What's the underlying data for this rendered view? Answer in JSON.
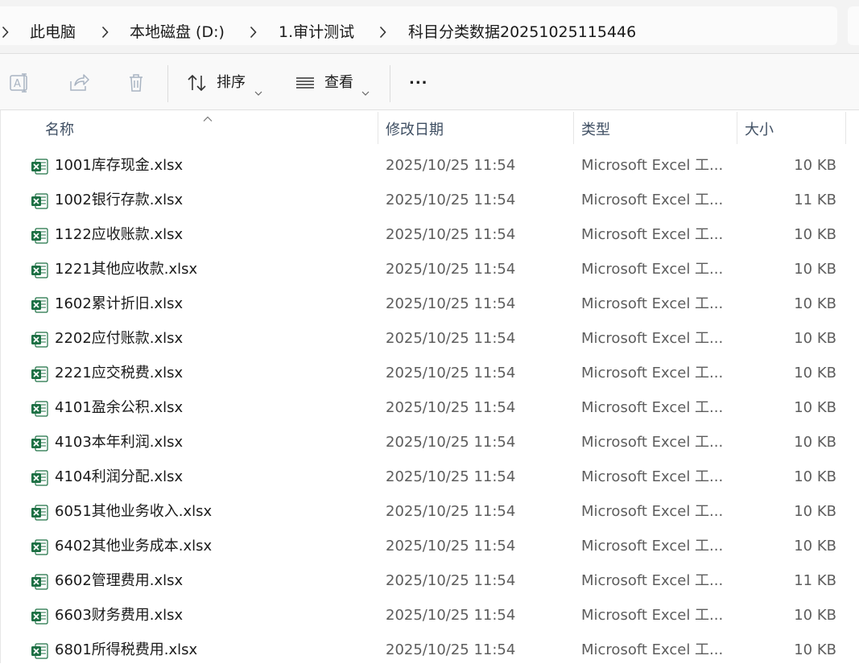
{
  "breadcrumb": {
    "items": [
      "此电脑",
      "本地磁盘 (D:)",
      "1.审计测试",
      "科目分类数据20251025115446"
    ]
  },
  "toolbar": {
    "sort_label": "排序",
    "view_label": "查看",
    "more_label": "..."
  },
  "columns": {
    "name": "名称",
    "date": "修改日期",
    "type": "类型",
    "size": "大小"
  },
  "files": [
    {
      "name": "1001库存现金.xlsx",
      "date": "2025/10/25 11:54",
      "type": "Microsoft Excel 工...",
      "size": "10 KB"
    },
    {
      "name": "1002银行存款.xlsx",
      "date": "2025/10/25 11:54",
      "type": "Microsoft Excel 工...",
      "size": "11 KB"
    },
    {
      "name": "1122应收账款.xlsx",
      "date": "2025/10/25 11:54",
      "type": "Microsoft Excel 工...",
      "size": "10 KB"
    },
    {
      "name": "1221其他应收款.xlsx",
      "date": "2025/10/25 11:54",
      "type": "Microsoft Excel 工...",
      "size": "10 KB"
    },
    {
      "name": "1602累计折旧.xlsx",
      "date": "2025/10/25 11:54",
      "type": "Microsoft Excel 工...",
      "size": "10 KB"
    },
    {
      "name": "2202应付账款.xlsx",
      "date": "2025/10/25 11:54",
      "type": "Microsoft Excel 工...",
      "size": "10 KB"
    },
    {
      "name": "2221应交税费.xlsx",
      "date": "2025/10/25 11:54",
      "type": "Microsoft Excel 工...",
      "size": "10 KB"
    },
    {
      "name": "4101盈余公积.xlsx",
      "date": "2025/10/25 11:54",
      "type": "Microsoft Excel 工...",
      "size": "10 KB"
    },
    {
      "name": "4103本年利润.xlsx",
      "date": "2025/10/25 11:54",
      "type": "Microsoft Excel 工...",
      "size": "10 KB"
    },
    {
      "name": "4104利润分配.xlsx",
      "date": "2025/10/25 11:54",
      "type": "Microsoft Excel 工...",
      "size": "10 KB"
    },
    {
      "name": "6051其他业务收入.xlsx",
      "date": "2025/10/25 11:54",
      "type": "Microsoft Excel 工...",
      "size": "10 KB"
    },
    {
      "name": "6402其他业务成本.xlsx",
      "date": "2025/10/25 11:54",
      "type": "Microsoft Excel 工...",
      "size": "10 KB"
    },
    {
      "name": "6602管理费用.xlsx",
      "date": "2025/10/25 11:54",
      "type": "Microsoft Excel 工...",
      "size": "11 KB"
    },
    {
      "name": "6603财务费用.xlsx",
      "date": "2025/10/25 11:54",
      "type": "Microsoft Excel 工...",
      "size": "10 KB"
    },
    {
      "name": "6801所得税费用.xlsx",
      "date": "2025/10/25 11:54",
      "type": "Microsoft Excel 工...",
      "size": "10 KB"
    }
  ],
  "colors": {
    "excel_green": "#1d7044",
    "toolbar_bg": "#f9f9f9",
    "address_bg": "#f3f3f3",
    "header_text": "#3f4f63"
  },
  "icons": {
    "toolbar": [
      "rename-icon",
      "share-icon",
      "delete-icon",
      "sort-icon",
      "view-icon"
    ],
    "file": "excel-file-icon"
  }
}
